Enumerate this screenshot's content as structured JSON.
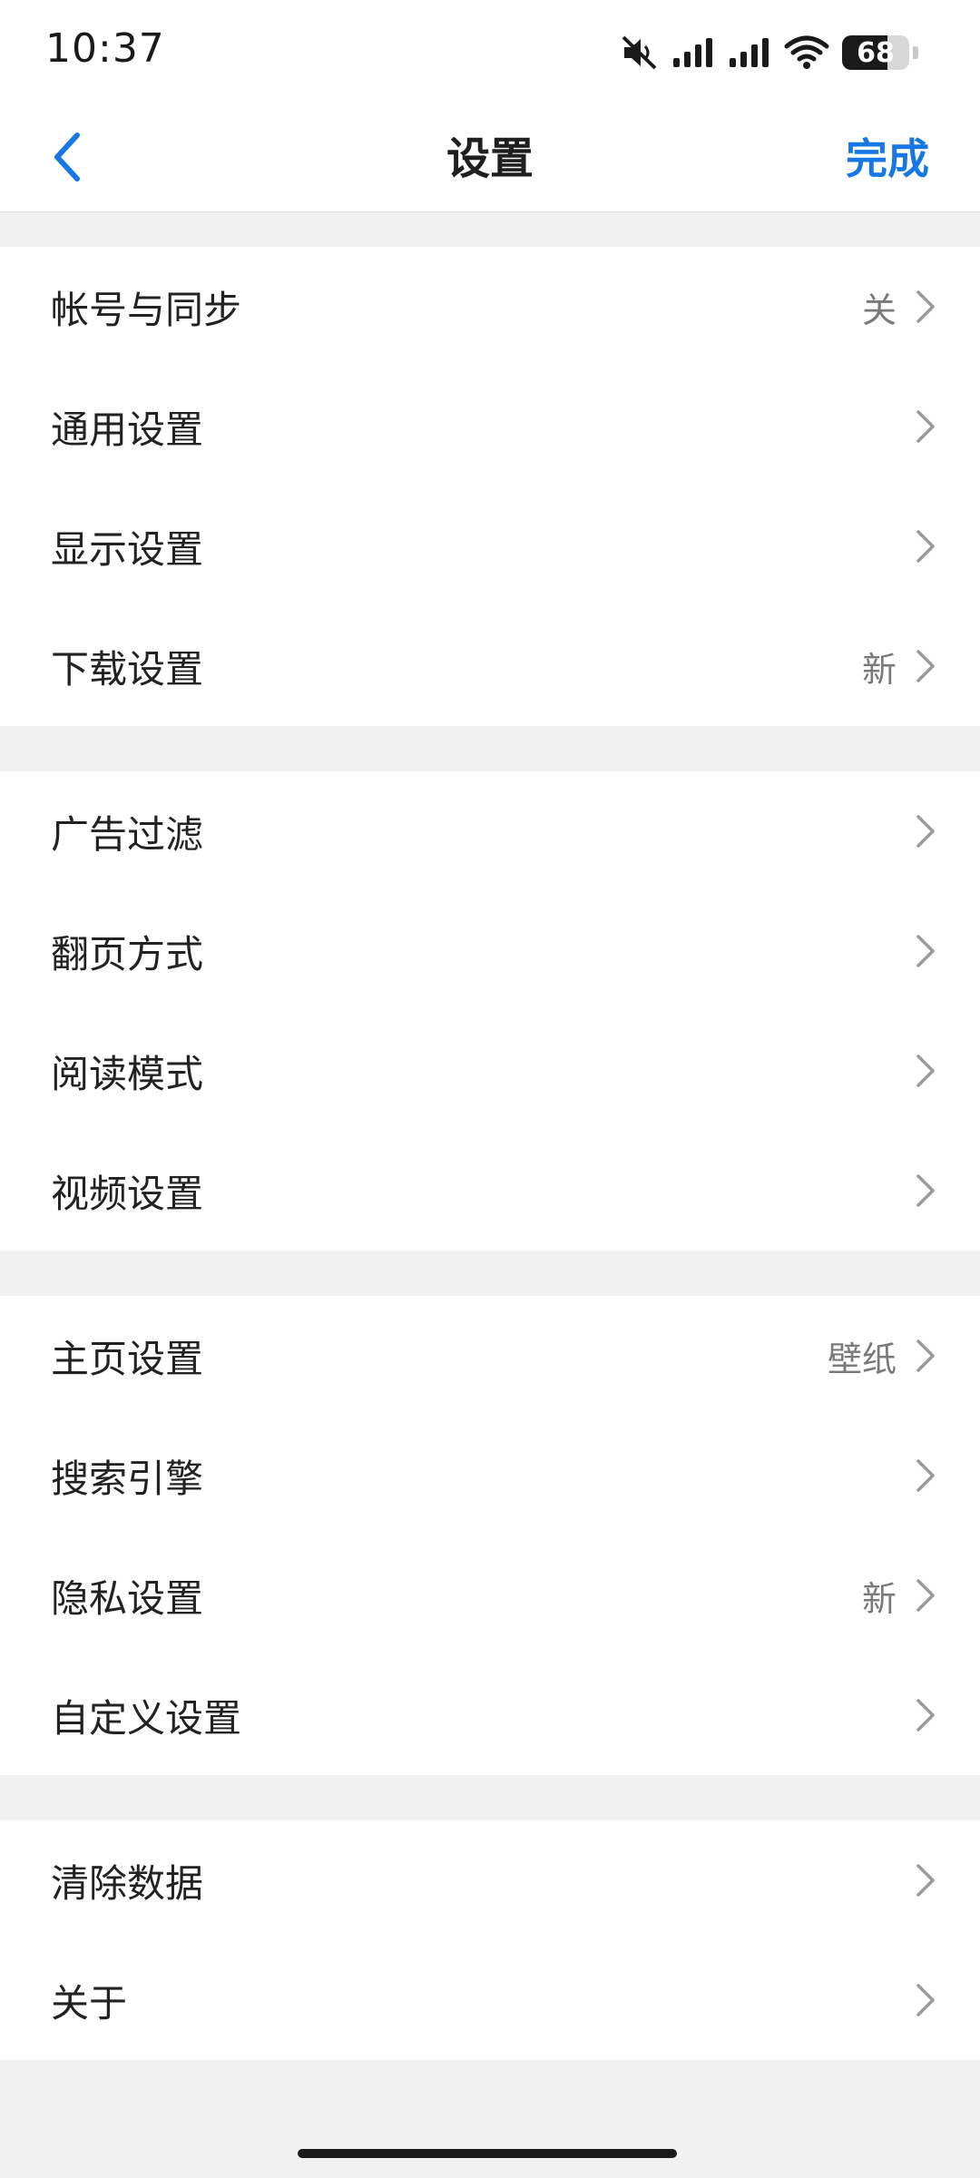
{
  "status_bar": {
    "time": "10:37",
    "battery_level": "68",
    "icons": [
      "mute-icon",
      "signal-icon",
      "signal-icon",
      "wifi-icon",
      "battery-icon"
    ]
  },
  "nav": {
    "back_icon": "chevron-left-icon",
    "title": "设置",
    "done_label": "完成",
    "accent_color": "#1677e5"
  },
  "groups": [
    {
      "items": [
        {
          "label": "帐号与同步",
          "value": "关"
        },
        {
          "label": "通用设置",
          "value": ""
        },
        {
          "label": "显示设置",
          "value": ""
        },
        {
          "label": "下载设置",
          "value": "新"
        }
      ]
    },
    {
      "items": [
        {
          "label": "广告过滤",
          "value": ""
        },
        {
          "label": "翻页方式",
          "value": ""
        },
        {
          "label": "阅读模式",
          "value": ""
        },
        {
          "label": "视频设置",
          "value": ""
        }
      ]
    },
    {
      "items": [
        {
          "label": "主页设置",
          "value": "壁纸"
        },
        {
          "label": "搜索引擎",
          "value": ""
        },
        {
          "label": "隐私设置",
          "value": "新"
        },
        {
          "label": "自定义设置",
          "value": ""
        }
      ]
    },
    {
      "items": [
        {
          "label": "清除数据",
          "value": ""
        },
        {
          "label": "关于",
          "value": ""
        }
      ]
    }
  ]
}
